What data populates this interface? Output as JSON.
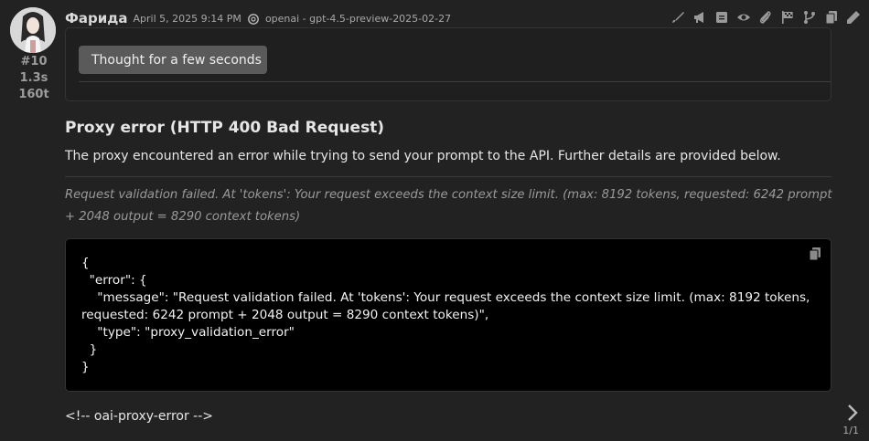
{
  "message": {
    "author": "Фарида",
    "date": "April 5, 2025 9:14 PM",
    "model": "openai - gpt-4.5-preview-2025-02-27",
    "mesid": "#10",
    "timer": "1.3s",
    "tokens": "160t"
  },
  "toolbar": {
    "icons": [
      "brush-icon",
      "megaphone-icon",
      "note-icon",
      "eye-icon",
      "paperclip-icon",
      "flag-icon",
      "branch-icon",
      "copy-icon",
      "edit-icon"
    ]
  },
  "reasoning": {
    "label": "Thought for a few seconds"
  },
  "error": {
    "title": "Proxy error (HTTP 400 Bad Request)",
    "description": "The proxy encountered an error while trying to send your prompt to the API. Further details are provided below.",
    "detail": "Request validation failed. At 'tokens': Your request exceeds the context size limit. (max: 8192 tokens, requested: 6242 prompt + 2048 output = 8290 context tokens)",
    "code": "{\n  \"error\": {\n    \"message\": \"Request validation failed. At 'tokens': Your request exceeds the context size limit. (max: 8192 tokens, requested: 6242 prompt + 2048 output = 8290 context tokens)\",\n    \"type\": \"proxy_validation_error\"\n  }\n}",
    "footer": "<!-- oai-proxy-error -->"
  },
  "swipe": {
    "counter": "1/1"
  },
  "colors": {
    "background": "#222222",
    "code_background": "#000000",
    "button": "#5a5a5a"
  }
}
